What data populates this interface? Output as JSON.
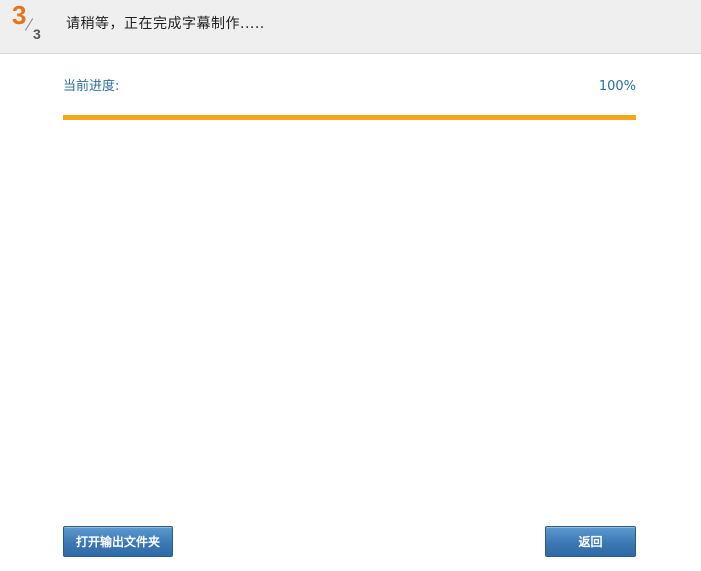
{
  "header": {
    "step_current": "3",
    "step_total": "3",
    "title": "请稍等，正在完成字幕制作....."
  },
  "progress": {
    "label": "当前进度:",
    "value_text": "100%",
    "fraction": 1.0,
    "fill_color": "#f2a71b"
  },
  "buttons": {
    "open_folder": "打开输出文件夹",
    "back": "返回"
  },
  "colors": {
    "accent_orange": "#e8731a",
    "label_blue": "#2b6f9c",
    "button_blue": "#3b78b5"
  }
}
